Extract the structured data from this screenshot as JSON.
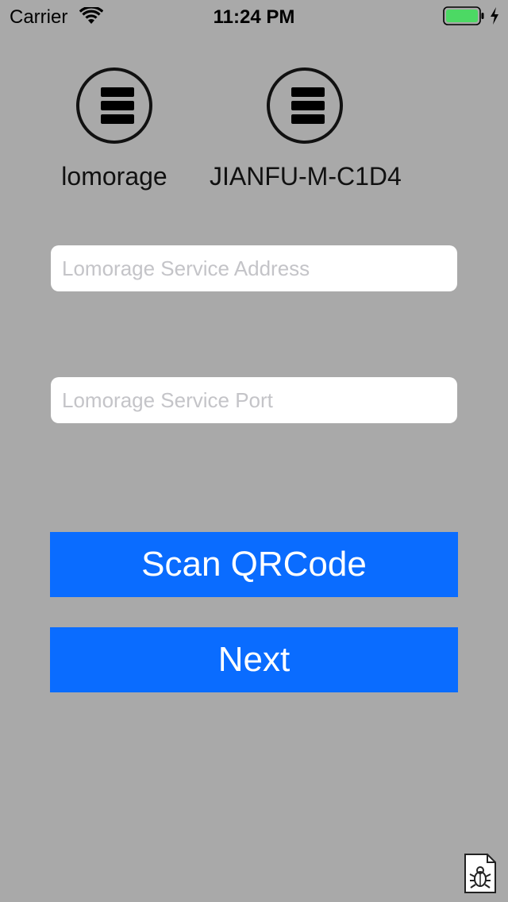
{
  "status_bar": {
    "carrier": "Carrier",
    "time": "11:24 PM",
    "battery_color": "#4cd964"
  },
  "servers": [
    {
      "name": "lomorage",
      "icon": "server-stack-icon"
    },
    {
      "name": "JIANFU-M-C1D4",
      "icon": "server-stack-icon"
    }
  ],
  "form": {
    "address_placeholder": "Lomorage Service Address",
    "port_placeholder": "Lomorage Service Port"
  },
  "buttons": {
    "scan_label": "Scan QRCode",
    "next_label": "Next"
  },
  "colors": {
    "background": "#a9a9a9",
    "button": "#0a6cff"
  },
  "debug_icon": "bug-report-icon"
}
